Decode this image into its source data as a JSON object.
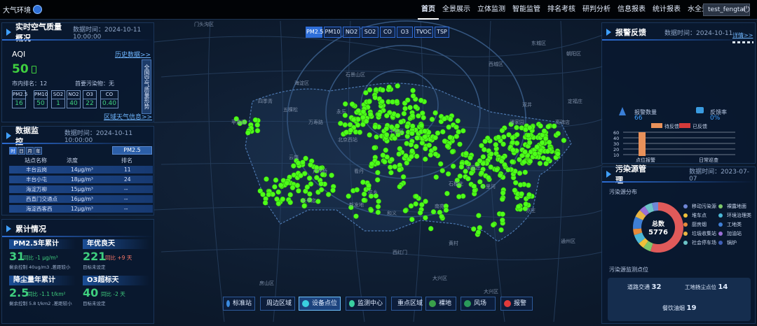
{
  "nav": {
    "logo": "大气环境",
    "items": [
      "首页",
      "全景展示",
      "立体监测",
      "智能监管",
      "排名考核",
      "研判分析",
      "信息报表",
      "统计报表",
      "水全景展示"
    ],
    "user": "test_fengtai"
  },
  "aq": {
    "title": "实时空气质量概况",
    "time": "数据时间：2024-10-11 10:00:00",
    "aqi_label": "AQI",
    "aqi_value": "50",
    "history_link": "历史数据>>",
    "rank": "市内排名：12",
    "primary": "首要污染物：无",
    "side_label": "全国空气质量形势",
    "region_link": "区域天气信息>>",
    "pollutants": [
      {
        "name": "PM2.5",
        "value": "16"
      },
      {
        "name": "PM10",
        "value": "50"
      },
      {
        "name": "SO2",
        "value": "1"
      },
      {
        "name": "NO2",
        "value": "40"
      },
      {
        "name": "O3",
        "value": "22"
      },
      {
        "name": "CO",
        "value": "0.40"
      }
    ]
  },
  "monitor": {
    "title": "数据监控",
    "time": "数据时间：2024-10-11 10:00:00",
    "tabs": [
      "时",
      "日",
      "月",
      "年"
    ],
    "selector": "PM2.5",
    "headers": [
      "站点名称",
      "浓度",
      "排名"
    ],
    "rows": [
      {
        "name": "丰台云岗",
        "conc": "14μg/m³",
        "rank": "11"
      },
      {
        "name": "丰台小屯",
        "conc": "18μg/m³",
        "rank": "24"
      },
      {
        "name": "海淀万柳",
        "conc": "15μg/m³",
        "rank": "--"
      },
      {
        "name": "西直门交通点",
        "conc": "16μg/m³",
        "rank": "--"
      },
      {
        "name": "海淀西客西",
        "conc": "12μg/m³",
        "rank": "--"
      }
    ]
  },
  "cumulative": {
    "title": "累计情况",
    "cards": [
      {
        "title": "PM2.5年累计",
        "value": "31",
        "cmp": "同比 -1 μg/m³",
        "note": "剩余控制 40ug/m3 ,差距较小"
      },
      {
        "title": "年优良天",
        "value": "221",
        "cmp": "同比 +9 天",
        "note": "目标未设定"
      },
      {
        "title": "降尘量年累计",
        "value": "2.5",
        "cmp": "同比 -1.1 t/km²",
        "note": "剩余控制 5.8 t/km2 ,差距较小"
      },
      {
        "title": "O3超标天",
        "value": "40",
        "cmp": "同比 -2 天",
        "note": "目标未设定"
      }
    ]
  },
  "pollutant_tabs": [
    "PM2.5",
    "PM10",
    "NO2",
    "SO2",
    "CO",
    "O3",
    "TVOC",
    "TSP"
  ],
  "bottom_buttons": [
    "标准站",
    "周边区域",
    "设备点位",
    "监测中心",
    "重点区域",
    "裸地",
    "风场",
    "报警"
  ],
  "map_labels": [
    "门头沟区",
    "石景山区",
    "海淀区",
    "西城区",
    "东城区",
    "朝阳区",
    "丰台区",
    "房山区",
    "大兴区",
    "大兴区",
    "通州区",
    "十里河",
    "南苑",
    "北京西站",
    "卢沟桥",
    "云岗",
    "长辛店",
    "亦庄",
    "看丹",
    "花乡",
    "新发地",
    "宋家庄",
    "石榴庄",
    "和义",
    "黄村",
    "西红门",
    "潘家园",
    "双井",
    "高碑店",
    "定福庄",
    "永乐",
    "万寿路",
    "五棵松",
    "四季青",
    "苹果园"
  ],
  "alarm": {
    "title": "报警反馈",
    "time": "数据时间：2024-10-11",
    "link": "详情>>",
    "count_label": "报警数量",
    "count_value": "66",
    "feedback_label": "反馈率",
    "feedback_value": "0%",
    "legend_pending": "待反馈",
    "legend_done": "已反馈",
    "x_labels": [
      "点位报警",
      "日常巡查"
    ],
    "y_ticks": [
      "60",
      "40",
      "30",
      "20",
      "10"
    ],
    "bar_value": 66,
    "colors": {
      "pending": "#e8915a",
      "done": "#d43a3a"
    }
  },
  "pollution": {
    "title": "污染源管理",
    "time": "数据时间：2023-07-07",
    "dist_label": "污染源分布",
    "total_label": "总数",
    "total_value": "5776",
    "legend": [
      {
        "name": "移动污染源",
        "color": "#6f86d6"
      },
      {
        "name": "裸露地面",
        "color": "#7ec86b"
      },
      {
        "name": "堆车点",
        "color": "#f0c13a"
      },
      {
        "name": "环境治理类",
        "color": "#4bb7d6"
      },
      {
        "name": "厨房烟",
        "color": "#e68a3a"
      },
      {
        "name": "工地类",
        "color": "#3f7fd6"
      },
      {
        "name": "垃圾收集站",
        "color": "#e9b544"
      },
      {
        "name": "加油站",
        "color": "#9a6fd6"
      },
      {
        "name": "社会停车场",
        "color": "#6bc4c8"
      },
      {
        "name": "锅炉",
        "color": "#3f5fb8"
      }
    ],
    "monitor_label": "污染源监测点位",
    "items": [
      {
        "label": "道路交通",
        "value": "32"
      },
      {
        "label": "工地扬尘点位",
        "value": "14"
      },
      {
        "label": "餐饮油烟",
        "value": "19"
      }
    ]
  }
}
